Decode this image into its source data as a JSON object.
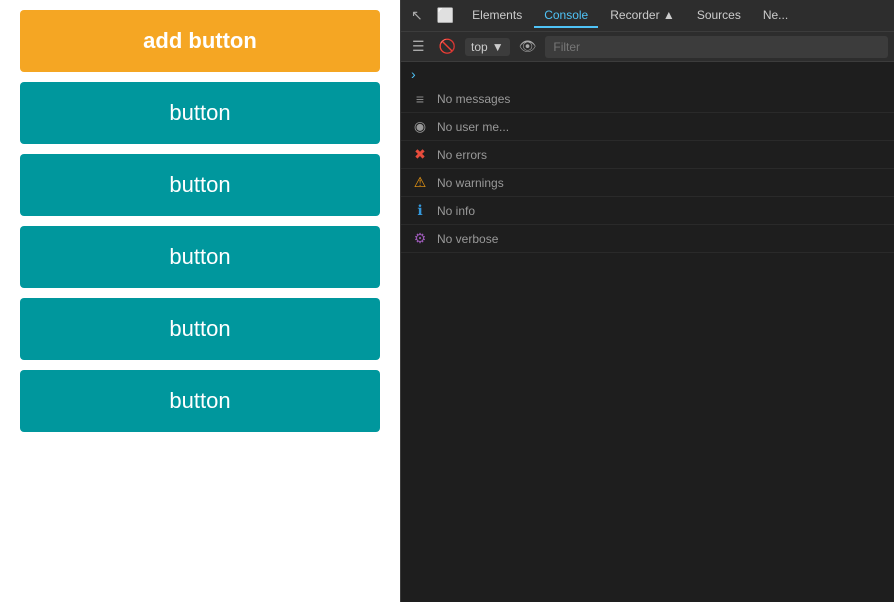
{
  "leftPanel": {
    "addButton": "add button",
    "buttons": [
      {
        "label": "button"
      },
      {
        "label": "button"
      },
      {
        "label": "button"
      },
      {
        "label": "button"
      },
      {
        "label": "button"
      }
    ]
  },
  "devtools": {
    "tabs": [
      {
        "label": "Elements",
        "active": false
      },
      {
        "label": "Console",
        "active": true
      },
      {
        "label": "Recorder ▲",
        "active": false
      },
      {
        "label": "Sources",
        "active": false
      },
      {
        "label": "Ne...",
        "active": false
      }
    ],
    "toolbar": {
      "context": "top",
      "filterPlaceholder": "Filter"
    },
    "messages": [
      {
        "icon": "≡",
        "iconClass": "messages",
        "text": "No messages"
      },
      {
        "icon": "👤",
        "iconClass": "user",
        "text": "No user me..."
      },
      {
        "icon": "✖",
        "iconClass": "error",
        "text": "No errors"
      },
      {
        "icon": "⚠",
        "iconClass": "warning",
        "text": "No warnings"
      },
      {
        "icon": "ℹ",
        "iconClass": "info",
        "text": "No info"
      },
      {
        "icon": "🐛",
        "iconClass": "verbose",
        "text": "No verbose"
      }
    ]
  }
}
